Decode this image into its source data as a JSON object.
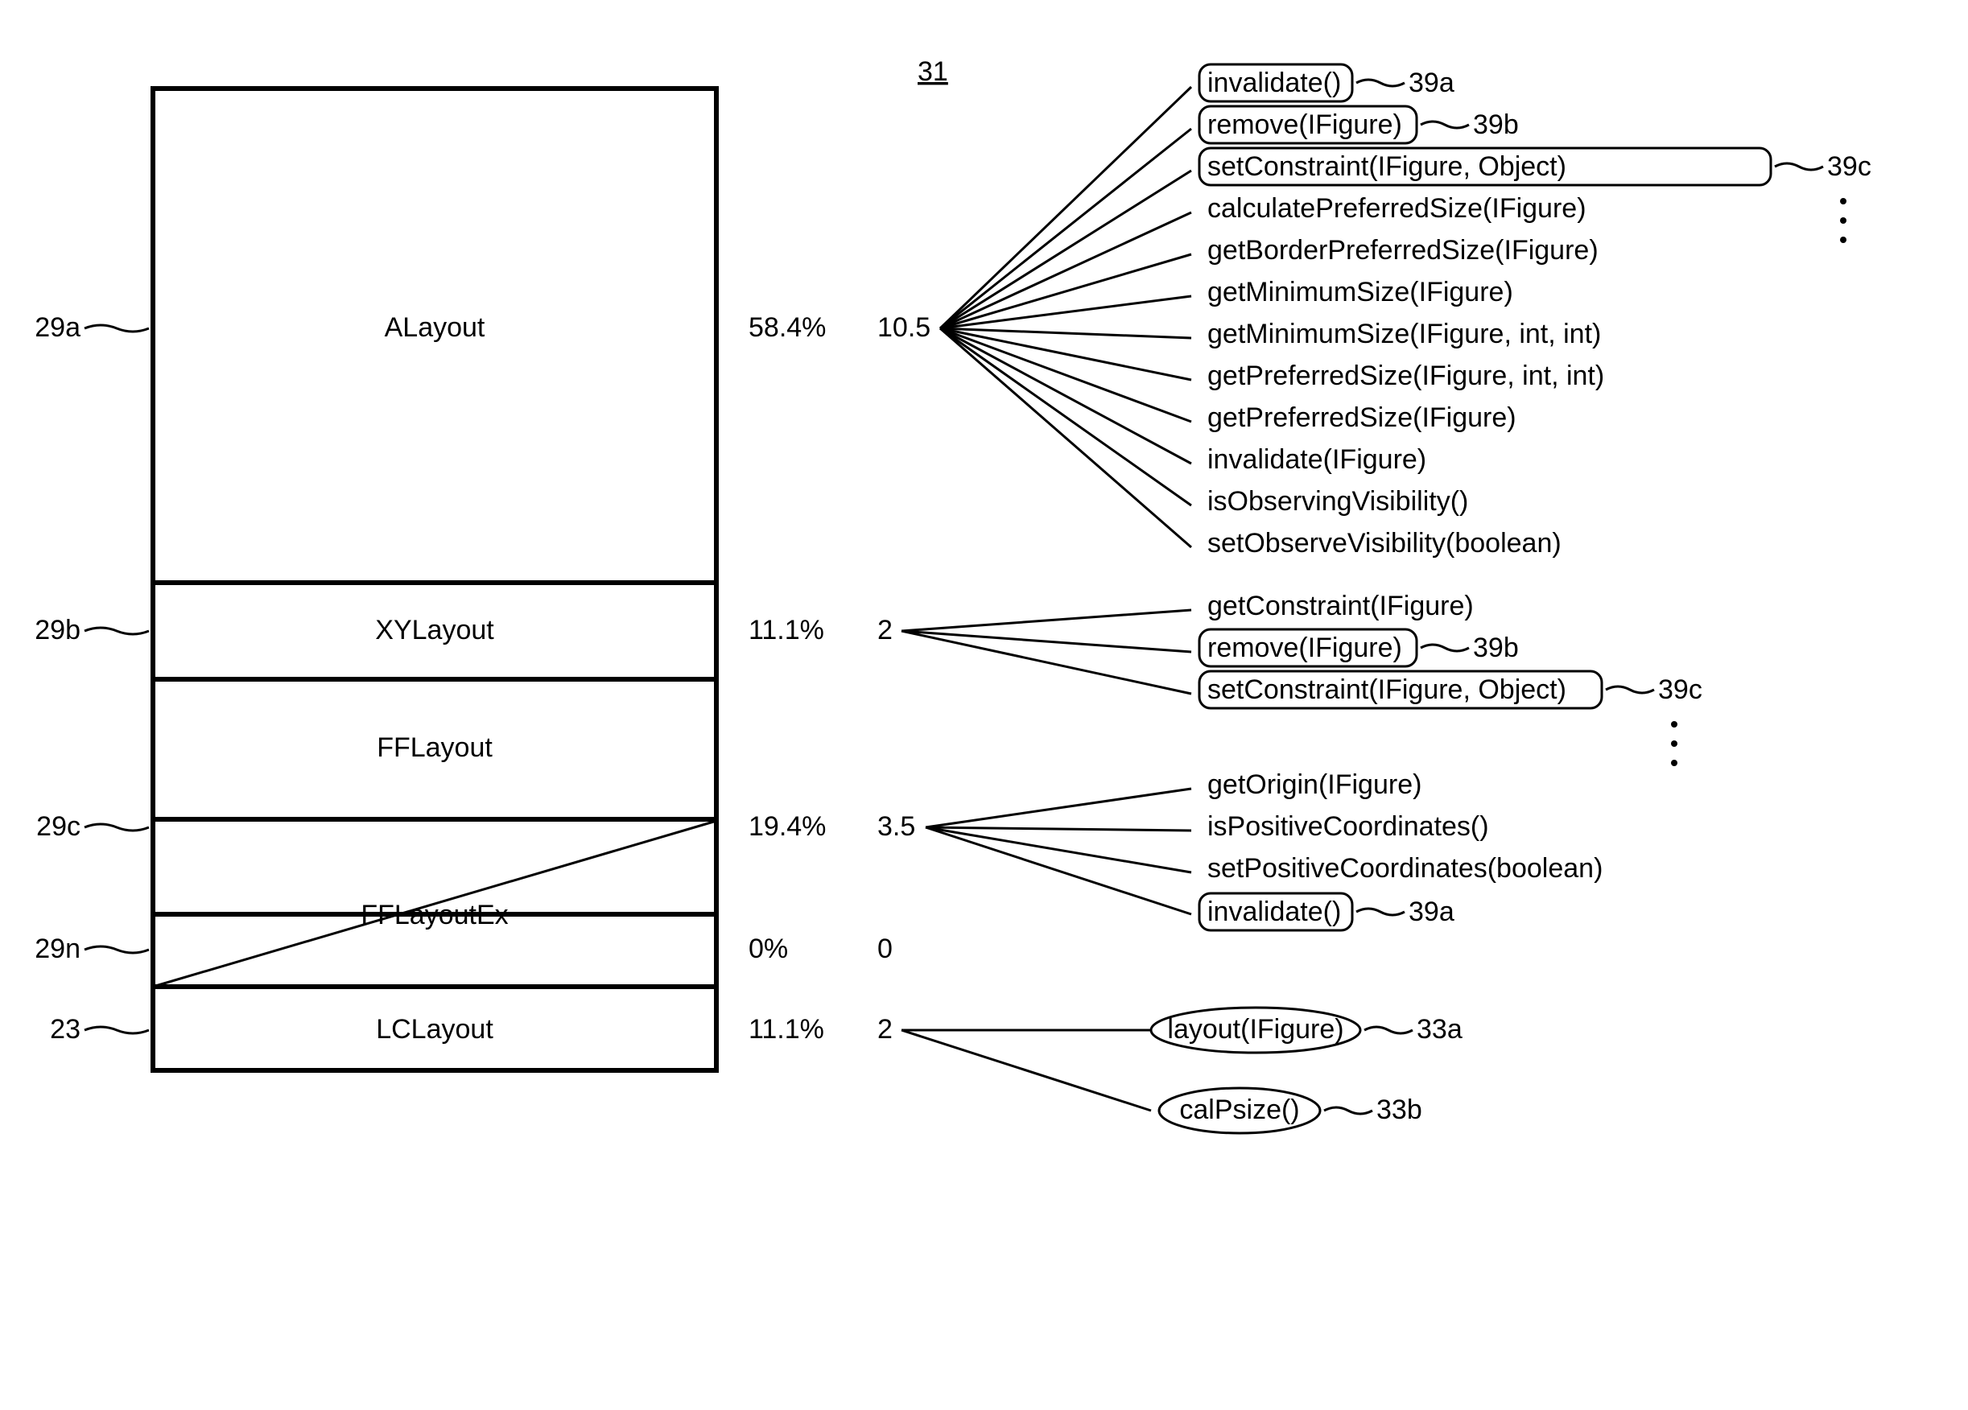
{
  "figure_label": "31",
  "chart_data": {
    "type": "table",
    "columns": [
      "ref",
      "class",
      "percent",
      "count"
    ],
    "rows": [
      {
        "ref": "29a",
        "class": "ALayout",
        "percent": "58.4%",
        "count": "10.5"
      },
      {
        "ref": "29b",
        "class": "XYLayout",
        "percent": "11.1%",
        "count": "2"
      },
      {
        "ref": "29c",
        "class": "FFLayout",
        "percent": "19.4%",
        "count": "3.5"
      },
      {
        "ref": "29n",
        "class": "FFLayoutEx",
        "percent": "0%",
        "count": "0"
      },
      {
        "ref": "23",
        "class": "LCLayout",
        "percent": "11.1%",
        "count": "2"
      }
    ]
  },
  "rows": {
    "0": {
      "ref": "29a",
      "class": "ALayout",
      "percent": "58.4%",
      "count": "10.5"
    },
    "1": {
      "ref": "29b",
      "class": "XYLayout",
      "percent": "11.1%",
      "count": "2"
    },
    "2": {
      "ref": "29c",
      "class": "FFLayout",
      "percent": "19.4%",
      "count": "3.5"
    },
    "3": {
      "ref": "29n",
      "class": "FFLayoutEx",
      "percent": "0%",
      "count": "0"
    },
    "4": {
      "ref": "23",
      "class": "LCLayout",
      "percent": "11.1%",
      "count": "2"
    }
  },
  "methods_a": {
    "0": {
      "text": "invalidate()",
      "ref": "39a",
      "boxed": true
    },
    "1": {
      "text": "remove(IFigure)",
      "ref": "39b",
      "boxed": true
    },
    "2": {
      "text": "setConstraint(IFigure, Object)",
      "ref": "39c",
      "boxed": true
    },
    "3": {
      "text": "calculatePreferredSize(IFigure)",
      "ref": "",
      "boxed": false
    },
    "4": {
      "text": "getBorderPreferredSize(IFigure)",
      "ref": "",
      "boxed": false
    },
    "5": {
      "text": "getMinimumSize(IFigure)",
      "ref": "",
      "boxed": false
    },
    "6": {
      "text": "getMinimumSize(IFigure, int, int)",
      "ref": "",
      "boxed": false
    },
    "7": {
      "text": "getPreferredSize(IFigure, int, int)",
      "ref": "",
      "boxed": false
    },
    "8": {
      "text": "getPreferredSize(IFigure)",
      "ref": "",
      "boxed": false
    },
    "9": {
      "text": "invalidate(IFigure)",
      "ref": "",
      "boxed": false
    },
    "10": {
      "text": "isObservingVisibility()",
      "ref": "",
      "boxed": false
    },
    "11": {
      "text": "setObserveVisibility(boolean)",
      "ref": "",
      "boxed": false
    }
  },
  "methods_b": {
    "0": {
      "text": "getConstraint(IFigure)",
      "ref": "",
      "boxed": false
    },
    "1": {
      "text": "remove(IFigure)",
      "ref": "39b",
      "boxed": true
    },
    "2": {
      "text": "setConstraint(IFigure, Object)",
      "ref": "39c",
      "boxed": true
    }
  },
  "methods_c": {
    "0": {
      "text": "getOrigin(IFigure)",
      "ref": "",
      "boxed": false
    },
    "1": {
      "text": "isPositiveCoordinates()",
      "ref": "",
      "boxed": false
    },
    "2": {
      "text": "setPositiveCoordinates(boolean)",
      "ref": "",
      "boxed": false
    },
    "3": {
      "text": "invalidate()",
      "ref": "39a",
      "boxed": true
    }
  },
  "methods_lc": {
    "0": {
      "text": "layout(IFigure)",
      "ref": "33a"
    },
    "1": {
      "text": "calPsize()",
      "ref": "33b"
    }
  }
}
